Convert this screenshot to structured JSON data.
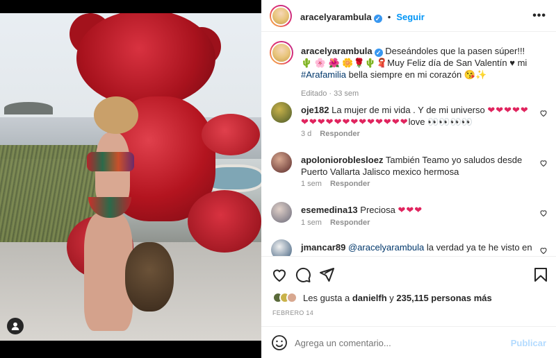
{
  "post": {
    "author": "aracelyarambula",
    "follow_label": "Seguir",
    "more_label": "•••",
    "caption_line1": "Deseándoles que la pasen súper!!! 🌵 🌸 🌺",
    "caption_line2": "🌼🌹🌵🧣Muy Feliz día de San Valentín ♥ mi ",
    "caption_hashtag": "#Arafamilia",
    "caption_line3": " bella siempre en mi corazón 😘✨",
    "caption_meta": "Editado · 33 sem"
  },
  "comments": [
    {
      "user": "oje182",
      "text": "La mujer de mi vida . Y de mi universo ",
      "hearts": "❤❤❤❤❤❤❤❤❤❤❤❤❤❤❤❤❤❤",
      "tail": "love 👀👀👀👀",
      "time": "3 d",
      "reply": "Responder"
    },
    {
      "user": "apolonioroblesloez",
      "text": "También Teamo yo saludos desde Puerto Vallarta Jalisco mexico hermosa",
      "time": "1 sem",
      "reply": "Responder"
    },
    {
      "user": "esemedina13",
      "text": "Preciosa ",
      "hearts": "❤❤❤",
      "time": "1 sem",
      "reply": "Responder"
    },
    {
      "user": "jmancar89",
      "mention": "@aracelyarambula",
      "text": " la verdad ya te he visto en"
    }
  ],
  "likes": {
    "prefix": "Les gusta a ",
    "user": "danielfh",
    "middle": " y ",
    "count": "235,115 personas más"
  },
  "date": "FEBRERO 14",
  "composer": {
    "placeholder": "Agrega un comentario...",
    "publish": "Publicar"
  },
  "icons": {
    "like": "heart-icon",
    "comment": "comment-icon",
    "share": "send-icon",
    "save": "bookmark-icon",
    "emoji": "emoji-icon",
    "tag": "user-tag-icon"
  },
  "colors": {
    "accent": "#0095f6",
    "verified": "#3897f0",
    "muted": "#8e8e8e",
    "heart": "#e0245e"
  }
}
